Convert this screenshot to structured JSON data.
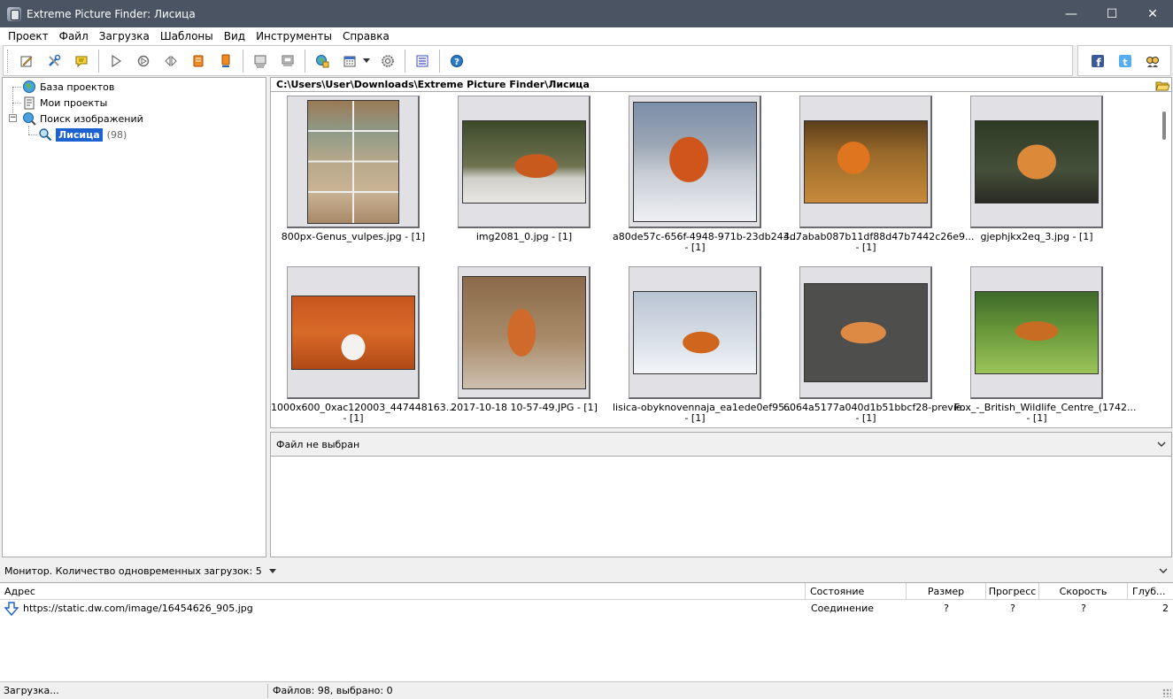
{
  "window": {
    "title": "Extreme Picture Finder: Лисица",
    "minimize": "—",
    "maximize": "☐",
    "close": "✕"
  },
  "menu": [
    "Проект",
    "Файл",
    "Загрузка",
    "Шаблоны",
    "Вид",
    "Инструменты",
    "Справка"
  ],
  "toolbar": {
    "icons": [
      "edit-project-icon",
      "project-properties-icon",
      "comment-icon",
      "start-icon",
      "reload-icon",
      "step-icon",
      "stop-icon",
      "pause-all-icon",
      "view-mode-icon",
      "preview-icon",
      "browse-images-icon",
      "calendar-scheduler-icon",
      "settings-gear-icon",
      "slideshow-icon",
      "help-icon"
    ],
    "social": [
      "facebook-icon",
      "twitter-icon",
      "support-icon"
    ],
    "colors": {
      "accent": "#1c63d1",
      "facebook": "#3b5998",
      "twitter": "#55acee"
    }
  },
  "tree": {
    "items": [
      {
        "label": "База проектов"
      },
      {
        "label": "Мои проекты"
      },
      {
        "label": "Поиск изображений"
      },
      {
        "label": "Лисица",
        "count": "(98)"
      }
    ]
  },
  "path": "C:\\Users\\User\\Downloads\\Extreme Picture Finder\\Лисица",
  "thumbnails": [
    {
      "line1": "800px-Genus_vulpes.jpg - [1]",
      "line2": ""
    },
    {
      "line1": "img2081_0.jpg - [1]",
      "line2": ""
    },
    {
      "line1": "a80de57c-656f-4948-971b-23db243...",
      "line2": "- [1]"
    },
    {
      "line1": "4d7abab087b11df88d47b7442c26e9...",
      "line2": "- [1]"
    },
    {
      "line1": "gjephjkx2eq_3.jpg - [1]",
      "line2": ""
    },
    {
      "line1": "1000x600_0xac120003_447448163...",
      "line2": "- [1]"
    },
    {
      "line1": "2017-10-18 10-57-49.JPG - [1]",
      "line2": ""
    },
    {
      "line1": "lisica-obyknovennaja_ea1ede0ef95...",
      "line2": "- [1]"
    },
    {
      "line1": "6064a5177a040d1b51bbcf28-previe...",
      "line2": "- [1]"
    },
    {
      "line1": "Fox_-_British_Wildlife_Centre_(1742...",
      "line2": "- [1]"
    }
  ],
  "fileinfo": {
    "title": "Файл не выбран"
  },
  "monitor": {
    "title": "Монитор. Количество одновременных загрузок: 5",
    "columns": [
      "Адрес",
      "Состояние",
      "Размер",
      "Прогресс",
      "Скорость",
      "Глубина"
    ],
    "columns_shown": [
      "Адрес",
      "Состояние",
      "Размер",
      "Прогресс",
      "Скорость",
      "Глуб..."
    ],
    "rows": [
      {
        "address": "https://static.dw.com/image/16454626_905.jpg",
        "state": "Соединение",
        "size": "?",
        "progress": "?",
        "speed": "?",
        "depth": "2"
      }
    ]
  },
  "status": {
    "left": "Загрузка...",
    "right": "Файлов: 98, выбрано: 0"
  }
}
